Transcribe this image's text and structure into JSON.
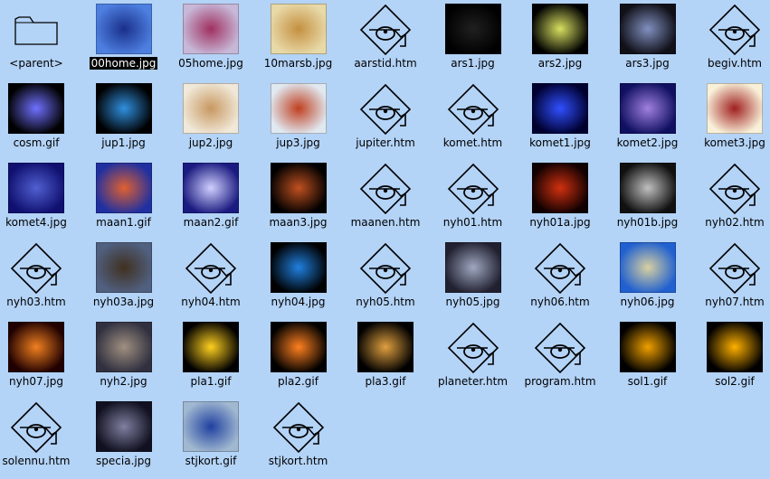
{
  "window": {
    "background": "#b3d3f7"
  },
  "files": [
    {
      "name": "<parent>",
      "type": "folder"
    },
    {
      "name": "00home.jpg",
      "type": "image",
      "selected": true,
      "colors": [
        "#4d7fe0",
        "#1a2f8a"
      ],
      "icon": "home-thumbnail"
    },
    {
      "name": "05home.jpg",
      "type": "image",
      "colors": [
        "#c7b8d8",
        "#a03060"
      ],
      "icon": "home-thumbnail"
    },
    {
      "name": "10marsb.jpg",
      "type": "image",
      "colors": [
        "#e8d9a8",
        "#c49040"
      ],
      "icon": "mars-thumbnail"
    },
    {
      "name": "aarstid.htm",
      "type": "html"
    },
    {
      "name": "ars1.jpg",
      "type": "image",
      "colors": [
        "#000000",
        "#202020"
      ],
      "icon": "starfield-thumbnail"
    },
    {
      "name": "ars2.jpg",
      "type": "image",
      "colors": [
        "#000000",
        "#d8e060"
      ],
      "icon": "galaxy-thumbnail"
    },
    {
      "name": "ars3.jpg",
      "type": "image",
      "colors": [
        "#101018",
        "#8090c0"
      ],
      "icon": "galaxy-thumbnail"
    },
    {
      "name": "begiv.htm",
      "type": "html"
    },
    {
      "name": "cosm.gif",
      "type": "image",
      "colors": [
        "#000000",
        "#7070ff"
      ],
      "icon": "cosmos-thumbnail"
    },
    {
      "name": "jup1.jpg",
      "type": "image",
      "colors": [
        "#000000",
        "#3090e0"
      ],
      "icon": "jupiter-thumbnail"
    },
    {
      "name": "jup2.jpg",
      "type": "image",
      "colors": [
        "#f0e8d8",
        "#c89860"
      ],
      "icon": "jupiter-thumbnail"
    },
    {
      "name": "jup3.jpg",
      "type": "image",
      "colors": [
        "#e0e8f0",
        "#c04020"
      ],
      "icon": "jupiter-surface-thumbnail"
    },
    {
      "name": "jupiter.htm",
      "type": "html"
    },
    {
      "name": "komet.htm",
      "type": "html"
    },
    {
      "name": "komet1.jpg",
      "type": "image",
      "colors": [
        "#000030",
        "#3050ff"
      ],
      "icon": "comet-thumbnail"
    },
    {
      "name": "komet2.jpg",
      "type": "image",
      "colors": [
        "#101060",
        "#a080e0"
      ],
      "icon": "comet-thumbnail"
    },
    {
      "name": "komet3.jpg",
      "type": "image",
      "colors": [
        "#f8f0d8",
        "#a02020"
      ],
      "icon": "comet-thumbnail"
    },
    {
      "name": "komet4.jpg",
      "type": "image",
      "colors": [
        "#101070",
        "#5060d0"
      ],
      "icon": "comet-thumbnail"
    },
    {
      "name": "maan1.gif",
      "type": "image",
      "colors": [
        "#2030a0",
        "#e06030"
      ],
      "icon": "moon-thumbnail"
    },
    {
      "name": "maan2.gif",
      "type": "image",
      "colors": [
        "#1a1a80",
        "#d0d0ff"
      ],
      "icon": "moon-thumbnail"
    },
    {
      "name": "maan3.jpg",
      "type": "image",
      "colors": [
        "#000000",
        "#c05020"
      ],
      "icon": "moon-thumbnail"
    },
    {
      "name": "maanen.htm",
      "type": "html"
    },
    {
      "name": "nyh01.htm",
      "type": "html"
    },
    {
      "name": "nyh01a.jpg",
      "type": "image",
      "colors": [
        "#100000",
        "#d03010"
      ],
      "icon": "nebula-thumbnail"
    },
    {
      "name": "nyh01b.jpg",
      "type": "image",
      "colors": [
        "#101010",
        "#c0c0c0"
      ],
      "icon": "nebula-thumbnail"
    },
    {
      "name": "nyh02.htm",
      "type": "html"
    },
    {
      "name": "nyh03.htm",
      "type": "html"
    },
    {
      "name": "nyh03a.jpg",
      "type": "image",
      "colors": [
        "#506080",
        "#403020"
      ],
      "icon": "photo-thumbnail"
    },
    {
      "name": "nyh04.htm",
      "type": "html"
    },
    {
      "name": "nyh04.jpg",
      "type": "image",
      "colors": [
        "#000000",
        "#2080e0"
      ],
      "icon": "planet-thumbnail"
    },
    {
      "name": "nyh05.htm",
      "type": "html"
    },
    {
      "name": "nyh05.jpg",
      "type": "image",
      "colors": [
        "#202030",
        "#a0a8c0"
      ],
      "icon": "planet-thumbnail"
    },
    {
      "name": "nyh06.htm",
      "type": "html"
    },
    {
      "name": "nyh06.jpg",
      "type": "image",
      "colors": [
        "#2060d0",
        "#d8d0a0"
      ],
      "icon": "photo-thumbnail"
    },
    {
      "name": "nyh07.htm",
      "type": "html"
    },
    {
      "name": "nyh07.jpg",
      "type": "image",
      "colors": [
        "#200000",
        "#f08020"
      ],
      "icon": "nebula-thumbnail"
    },
    {
      "name": "nyh2.jpg",
      "type": "image",
      "colors": [
        "#303040",
        "#a09080"
      ],
      "icon": "telescope-thumbnail"
    },
    {
      "name": "pla1.gif",
      "type": "image",
      "colors": [
        "#000000",
        "#ffd020"
      ],
      "icon": "solar-system-thumbnail"
    },
    {
      "name": "pla2.gif",
      "type": "image",
      "colors": [
        "#000000",
        "#ff8020"
      ],
      "icon": "solar-system-thumbnail"
    },
    {
      "name": "pla3.gif",
      "type": "image",
      "colors": [
        "#000000",
        "#e0a040"
      ],
      "icon": "chart-thumbnail"
    },
    {
      "name": "planeter.htm",
      "type": "html"
    },
    {
      "name": "program.htm",
      "type": "html"
    },
    {
      "name": "sol1.gif",
      "type": "image",
      "colors": [
        "#000000",
        "#f0a000"
      ],
      "icon": "sun-orbit-thumbnail"
    },
    {
      "name": "sol2.gif",
      "type": "image",
      "colors": [
        "#000000",
        "#ffb000"
      ],
      "icon": "sun-orbit-thumbnail"
    },
    {
      "name": "solennu.htm",
      "type": "html"
    },
    {
      "name": "specia.jpg",
      "type": "image",
      "colors": [
        "#101020",
        "#8080a0"
      ],
      "icon": "photo-thumbnail"
    },
    {
      "name": "stjkort.gif",
      "type": "image",
      "colors": [
        "#a0b8d0",
        "#2040a0"
      ],
      "icon": "star-map-thumbnail"
    },
    {
      "name": "stjkort.htm",
      "type": "html"
    }
  ]
}
